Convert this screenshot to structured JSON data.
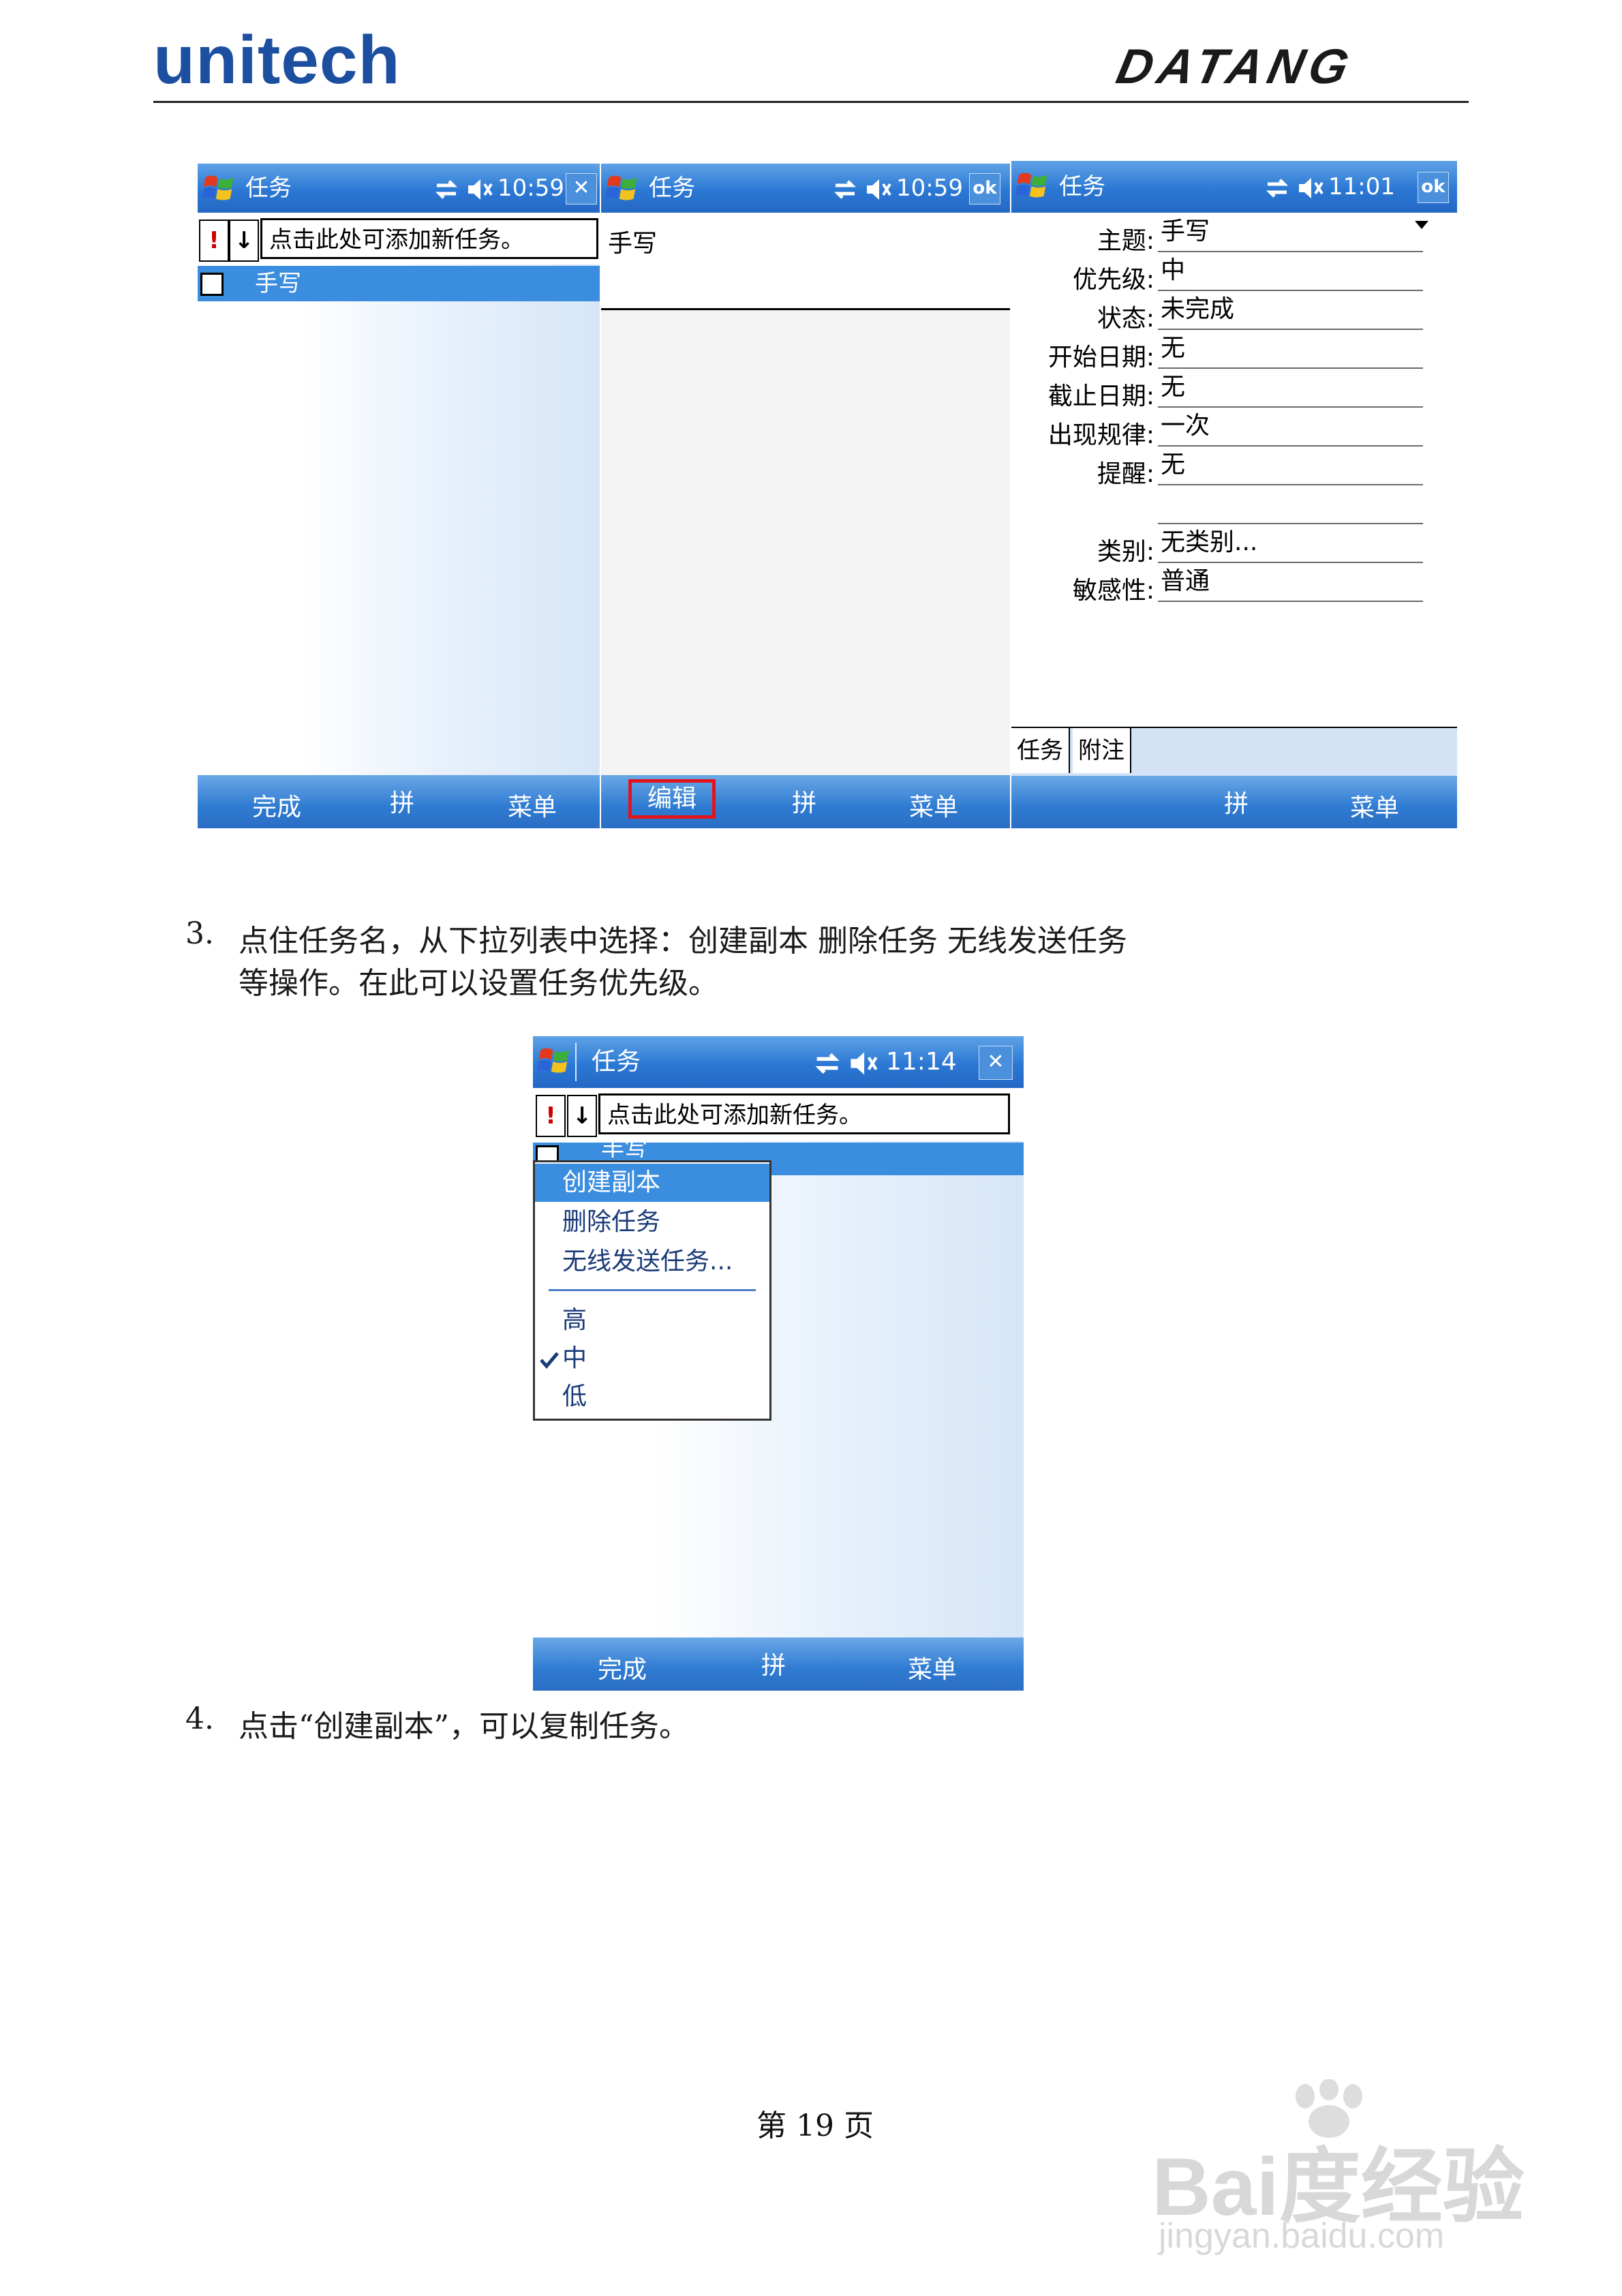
{
  "header": {
    "logo_left": "unitech",
    "logo_right": "DATANG"
  },
  "screens": {
    "task_list": {
      "title": "任务",
      "clock": "10:59",
      "close_btn": "✕",
      "add_task_placeholder": "点击此处可添加新任务。",
      "prio_high": "!",
      "sort": "↓",
      "task": "手写",
      "softkeys": {
        "left": "完成",
        "mid": "拼",
        "right": "菜单"
      }
    },
    "task_note": {
      "title": "任务",
      "clock": "10:59",
      "ok_btn": "ok",
      "note_text": "手写",
      "softkeys": {
        "left": "编辑",
        "mid": "拼",
        "right": "菜单"
      }
    },
    "task_detail": {
      "title": "任务",
      "clock": "11:01",
      "ok_btn": "ok",
      "fields": [
        {
          "label": "主题:",
          "value": "手写"
        },
        {
          "label": "优先级:",
          "value": "中"
        },
        {
          "label": "状态:",
          "value": "未完成"
        },
        {
          "label": "开始日期:",
          "value": "无"
        },
        {
          "label": "截止日期:",
          "value": "无"
        },
        {
          "label": "出现规律:",
          "value": "一次"
        },
        {
          "label": "提醒:",
          "value": "无"
        },
        {
          "label": "",
          "value": ""
        },
        {
          "label": "类别:",
          "value": "无类别..."
        },
        {
          "label": "敏感性:",
          "value": "普通"
        }
      ],
      "tabs": [
        "任务",
        "附注"
      ],
      "softkeys": {
        "mid": "拼",
        "right": "菜单"
      }
    },
    "context": {
      "title": "任务",
      "clock": "11:14",
      "close_btn": "✕",
      "add_task_placeholder": "点击此处可添加新任务。",
      "prio_high": "!",
      "sort": "↓",
      "task_partial": "手写",
      "menu": {
        "items": [
          "创建副本",
          "删除任务",
          "无线发送任务..."
        ],
        "priorities": [
          "高",
          "中",
          "低"
        ],
        "checked": "中"
      },
      "softkeys": {
        "left": "完成",
        "mid": "拼",
        "right": "菜单"
      }
    }
  },
  "body": {
    "step3_num": "3.",
    "step3_line1": "点住任务名，从下拉列表中选择：创建副本  删除任务  无线发送任务",
    "step3_line2": "等操作。在此可以设置任务优先级。",
    "step4_num": "4.",
    "step4_line": "点击“创建副本”，可以复制任务。"
  },
  "footer": {
    "page_number": "第 19 页"
  },
  "watermark": {
    "brand": "Bai度经验",
    "url": "jingyan.baidu.com"
  }
}
